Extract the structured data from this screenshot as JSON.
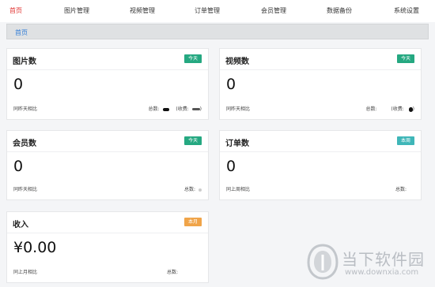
{
  "nav": {
    "items": [
      {
        "label": "首页",
        "active": true
      },
      {
        "label": "图片管理"
      },
      {
        "label": "视频管理"
      },
      {
        "label": "订单管理"
      },
      {
        "label": "会员管理"
      },
      {
        "label": "数据备份"
      },
      {
        "label": "系统设置"
      }
    ]
  },
  "breadcrumb": {
    "home": "首页"
  },
  "cards": {
    "images": {
      "title": "图片数",
      "badge": "今天",
      "value": "0",
      "compare": "同昨天相比",
      "total_label": "总数:",
      "extra_label": "(收费:"
    },
    "videos": {
      "title": "视频数",
      "badge": "今天",
      "value": "0",
      "compare": "同昨天相比",
      "total_label": "总数:",
      "extra_label": "(收费:"
    },
    "members": {
      "title": "会员数",
      "badge": "今天",
      "value": "0",
      "compare": "同昨天相比",
      "total_label": "总数:"
    },
    "orders": {
      "title": "订单数",
      "badge": "本周",
      "value": "0",
      "compare": "同上周相比",
      "total_label": "总数:"
    },
    "income": {
      "title": "收入",
      "badge": "本月",
      "value": "¥0.00",
      "compare": "同上月相比",
      "total_label": "总数:"
    }
  },
  "colors": {
    "active_nav": "#e0312f",
    "badge_today": "#25a881",
    "badge_week": "#3fb6b8",
    "badge_month": "#f0a449"
  },
  "watermark": {
    "name": "当下软件园",
    "url": "www.downxia.com"
  }
}
